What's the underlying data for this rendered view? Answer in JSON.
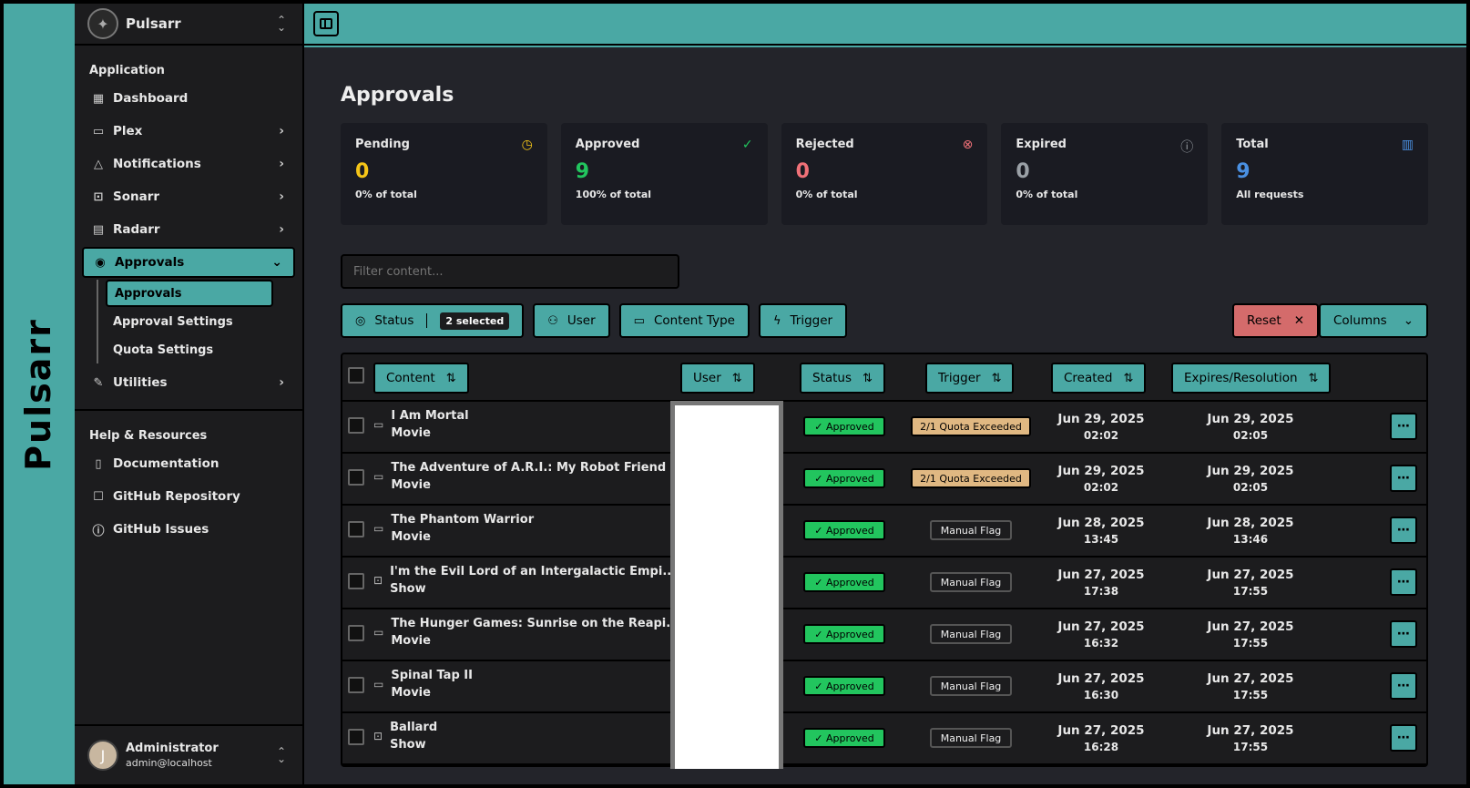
{
  "brand": "Pulsarr",
  "sidebar": {
    "app_name": "Pulsarr",
    "section_application": "Application",
    "items": [
      {
        "label": "Dashboard",
        "icon": "dashboard-icon"
      },
      {
        "label": "Plex",
        "icon": "monitor-icon"
      },
      {
        "label": "Notifications",
        "icon": "bell-icon"
      },
      {
        "label": "Sonarr",
        "icon": "tv-icon"
      },
      {
        "label": "Radarr",
        "icon": "film-icon"
      },
      {
        "label": "Approvals",
        "icon": "check-circle-icon"
      }
    ],
    "sub_items": [
      "Approvals",
      "Approval Settings",
      "Quota Settings"
    ],
    "utilities": "Utilities",
    "section_help": "Help & Resources",
    "help_items": [
      "Documentation",
      "GitHub Repository",
      "GitHub Issues"
    ],
    "user": {
      "initial": "J",
      "name": "Administrator",
      "email": "admin@localhost"
    }
  },
  "main": {
    "title": "Approvals",
    "stats": [
      {
        "label": "Pending",
        "value": "0",
        "sub": "0% of total",
        "color": "#f5c518",
        "icon": "clock-icon"
      },
      {
        "label": "Approved",
        "value": "9",
        "sub": "100% of total",
        "color": "#22c55e",
        "icon": "check-circle-icon"
      },
      {
        "label": "Rejected",
        "value": "0",
        "sub": "0% of total",
        "color": "#f07178",
        "icon": "x-circle-icon"
      },
      {
        "label": "Expired",
        "value": "0",
        "sub": "0% of total",
        "color": "#9aa0a6",
        "icon": "alert-circle-icon"
      },
      {
        "label": "Total",
        "value": "9",
        "sub": "All requests",
        "color": "#4a90e2",
        "icon": "bar-chart-icon"
      }
    ],
    "filter_placeholder": "Filter content...",
    "toolbar": {
      "status": "Status",
      "status_badge": "2 selected",
      "user": "User",
      "content_type": "Content Type",
      "trigger": "Trigger",
      "reset": "Reset",
      "columns": "Columns"
    },
    "table": {
      "headers": [
        "Content",
        "User",
        "Status",
        "Trigger",
        "Created",
        "Expires/Resolution"
      ],
      "rows": [
        {
          "title": "I Am Mortal",
          "type": "Movie",
          "icon": "monitor-icon",
          "status": "Approved",
          "trigger": "2/1 Quota Exceeded",
          "trigger_kind": "quota",
          "created_date": "Jun 29, 2025",
          "created_time": "02:02",
          "expires_date": "Jun 29, 2025",
          "expires_time": "02:05"
        },
        {
          "title": "The Adventure of A.R.I.: My Robot Friend",
          "type": "Movie",
          "icon": "monitor-icon",
          "status": "Approved",
          "trigger": "2/1 Quota Exceeded",
          "trigger_kind": "quota",
          "created_date": "Jun 29, 2025",
          "created_time": "02:02",
          "expires_date": "Jun 29, 2025",
          "expires_time": "02:05"
        },
        {
          "title": "The Phantom Warrior",
          "type": "Movie",
          "icon": "monitor-icon",
          "status": "Approved",
          "trigger": "Manual Flag",
          "trigger_kind": "manual",
          "created_date": "Jun 28, 2025",
          "created_time": "13:45",
          "expires_date": "Jun 28, 2025",
          "expires_time": "13:46"
        },
        {
          "title": "I'm the Evil Lord of an Intergalactic Empi...",
          "type": "Show",
          "icon": "tv-icon",
          "status": "Approved",
          "trigger": "Manual Flag",
          "trigger_kind": "manual",
          "created_date": "Jun 27, 2025",
          "created_time": "17:38",
          "expires_date": "Jun 27, 2025",
          "expires_time": "17:55"
        },
        {
          "title": "The Hunger Games: Sunrise on the Reapi...",
          "type": "Movie",
          "icon": "monitor-icon",
          "status": "Approved",
          "trigger": "Manual Flag",
          "trigger_kind": "manual",
          "created_date": "Jun 27, 2025",
          "created_time": "16:32",
          "expires_date": "Jun 27, 2025",
          "expires_time": "17:55"
        },
        {
          "title": "Spinal Tap II",
          "type": "Movie",
          "icon": "monitor-icon",
          "status": "Approved",
          "trigger": "Manual Flag",
          "trigger_kind": "manual",
          "created_date": "Jun 27, 2025",
          "created_time": "16:30",
          "expires_date": "Jun 27, 2025",
          "expires_time": "17:55"
        },
        {
          "title": "Ballard",
          "type": "Show",
          "icon": "tv-icon",
          "status": "Approved",
          "trigger": "Manual Flag",
          "trigger_kind": "manual",
          "created_date": "Jun 27, 2025",
          "created_time": "16:28",
          "expires_date": "Jun 27, 2025",
          "expires_time": "17:55"
        }
      ]
    }
  }
}
